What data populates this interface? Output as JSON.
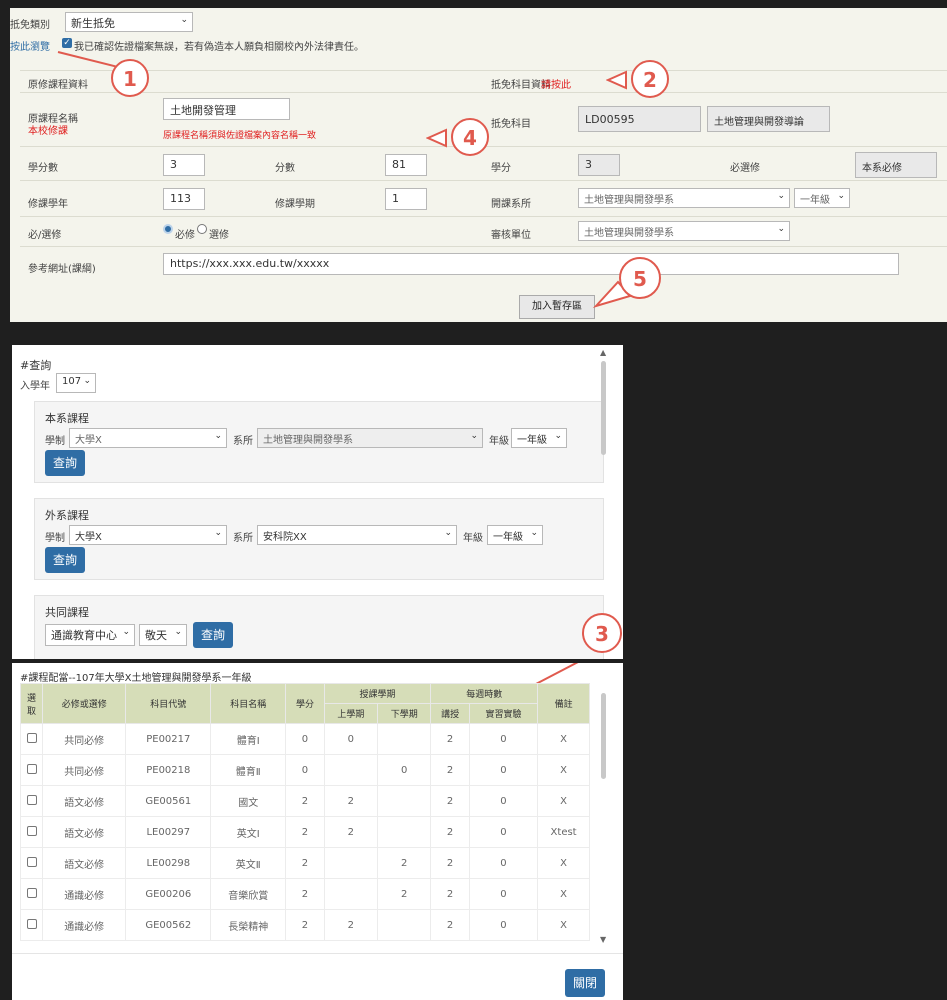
{
  "form": {
    "exempt_type_label": "抵免類別",
    "exempt_type_value": "新生抵免",
    "consent_prefix": "按此瀏覽",
    "consent_text": "我已確認佐證檔案無誤，若有偽造本人願負相關校內外法律責任。",
    "original_section_title": "原修課程資料",
    "target_section_title": "抵免科目資料",
    "target_section_link": "請按此",
    "course_name_label": "原課程名稱",
    "course_name_sublabel": "本校修課",
    "course_name_value": "土地開發管理",
    "course_name_warning": "原課程名稱須與佐證檔案內容名稱一致",
    "subject_label": "抵免科目",
    "subject_code": "LD00595",
    "subject_name": "土地管理與開發導論",
    "credits_label": "學分數",
    "credits_value": "3",
    "score_label": "分數",
    "score_value": "81",
    "target_credits_label": "學分",
    "target_credits_value": "3",
    "required_label": "必選修",
    "required_value": "本系必修",
    "year_label": "修課學年",
    "year_value": "113",
    "semester_label": "修課學期",
    "semester_value": "1",
    "dept_label": "開課系所",
    "dept_value": "土地管理與開發學系",
    "grade_value": "一年級",
    "req_elec_label": "必/選修",
    "req_option": "必修",
    "elec_option": "選修",
    "review_label": "審核單位",
    "review_value": "土地管理與開發學系",
    "url_label": "參考網址(課綱)",
    "url_value": "https://xxx.xxx.edu.tw/xxxxx",
    "add_button": "加入暫存區"
  },
  "callouts": [
    "1",
    "2",
    "3",
    "4",
    "5"
  ],
  "query": {
    "title": "#查詢",
    "entry_year_label": "入學年",
    "entry_year_value": "107",
    "dept_courses_title": "本系課程",
    "system_label": "學制",
    "system_value": "大學X",
    "dept_label": "系所",
    "dept_value": "土地管理與開發學系",
    "grade_label": "年級",
    "grade_value": "一年級",
    "search_button": "查詢",
    "other_courses_title": "外系課程",
    "other_system_value": "大學X",
    "other_dept_value": "安科院XX",
    "other_grade_value": "一年級",
    "common_courses_title": "共同課程",
    "center_value": "通識教育中心",
    "type_value": "敬天"
  },
  "table": {
    "title": "#課程配當--107年大學X土地管理與開發學系一年級",
    "headers": {
      "select": "選取",
      "type": "必修或選修",
      "code": "科目代號",
      "name": "科目名稱",
      "credits": "學分",
      "teach_sem": "授課學期",
      "first": "上學期",
      "second": "下學期",
      "weekly": "每週時數",
      "lecture": "講授",
      "lab": "實習實驗",
      "note": "備註"
    },
    "rows": [
      {
        "type": "共同必修",
        "code": "PE00217",
        "name": "體育Ⅰ",
        "credits": "0",
        "first": "0",
        "second": "",
        "lecture": "2",
        "lab": "0",
        "note": "X"
      },
      {
        "type": "共同必修",
        "code": "PE00218",
        "name": "體育Ⅱ",
        "credits": "0",
        "first": "",
        "second": "0",
        "lecture": "2",
        "lab": "0",
        "note": "X"
      },
      {
        "type": "語文必修",
        "code": "GE00561",
        "name": "國文",
        "credits": "2",
        "first": "2",
        "second": "",
        "lecture": "2",
        "lab": "0",
        "note": "X"
      },
      {
        "type": "語文必修",
        "code": "LE00297",
        "name": "英文Ⅰ",
        "credits": "2",
        "first": "2",
        "second": "",
        "lecture": "2",
        "lab": "0",
        "note": "Xtest"
      },
      {
        "type": "語文必修",
        "code": "LE00298",
        "name": "英文Ⅱ",
        "credits": "2",
        "first": "",
        "second": "2",
        "lecture": "2",
        "lab": "0",
        "note": "X"
      },
      {
        "type": "通識必修",
        "code": "GE00206",
        "name": "音樂欣賞",
        "credits": "2",
        "first": "",
        "second": "2",
        "lecture": "2",
        "lab": "0",
        "note": "X"
      },
      {
        "type": "通識必修",
        "code": "GE00562",
        "name": "長榮精神",
        "credits": "2",
        "first": "2",
        "second": "",
        "lecture": "2",
        "lab": "0",
        "note": "X"
      }
    ],
    "close_button": "關閉"
  },
  "colors": {
    "accent": "#2f6da5",
    "callout": "#e05a4e",
    "warning": "#e02020"
  }
}
